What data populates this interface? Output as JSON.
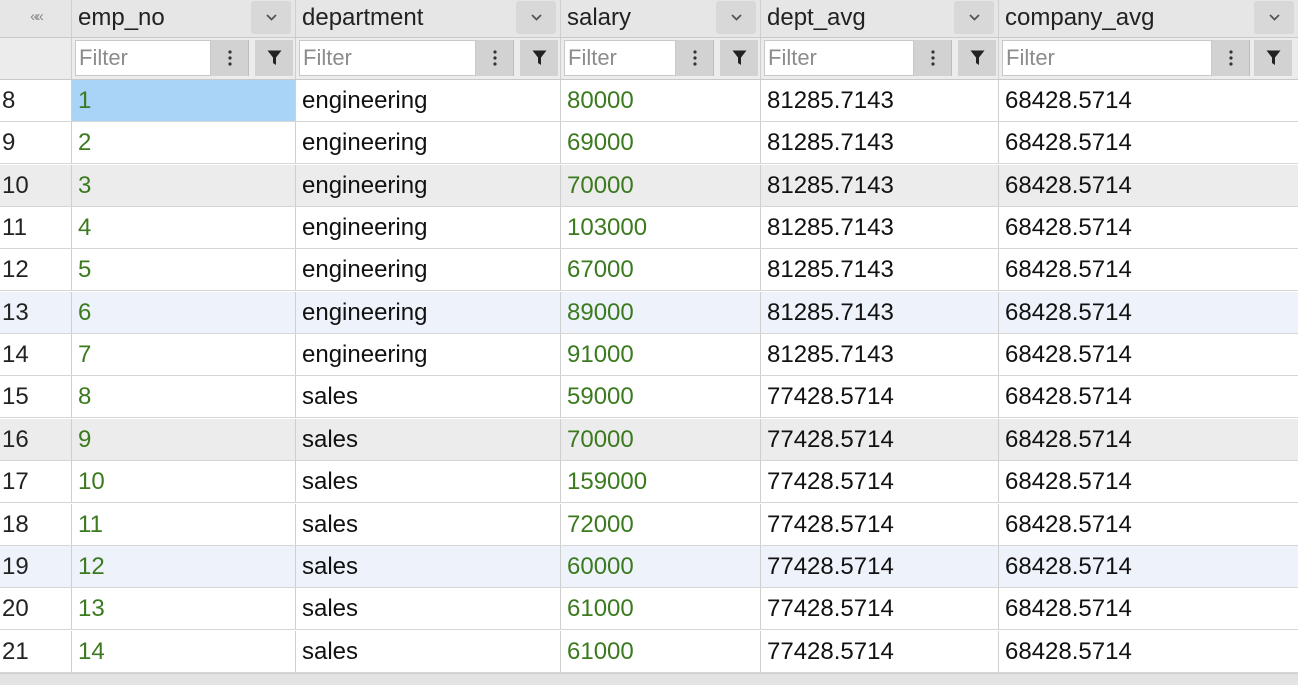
{
  "columns": [
    {
      "key": "emp_no",
      "label": "emp_no"
    },
    {
      "key": "department",
      "label": "department"
    },
    {
      "key": "salary",
      "label": "salary"
    },
    {
      "key": "dept_avg",
      "label": "dept_avg"
    },
    {
      "key": "company_avg",
      "label": "company_avg"
    }
  ],
  "collapse_glyph": "««",
  "filter_placeholder": "Filter",
  "colors": {
    "numeric_text": "#3b7a1f",
    "selected_cell": "#a9d3f7",
    "striped_row": "#ececec",
    "hover_row": "#eef3fb"
  },
  "icons": {
    "sort": "chevron-down-icon",
    "menu": "kebab-menu-icon",
    "filter": "funnel-icon"
  },
  "selected_cell": {
    "row": 0,
    "column": "emp_no"
  },
  "rows": [
    {
      "index": "8",
      "emp_no": "1",
      "department": "engineering",
      "salary": "80000",
      "dept_avg": "81285.7143",
      "company_avg": "68428.5714",
      "style": "even"
    },
    {
      "index": "9",
      "emp_no": "2",
      "department": "engineering",
      "salary": "69000",
      "dept_avg": "81285.7143",
      "company_avg": "68428.5714",
      "style": "even"
    },
    {
      "index": "10",
      "emp_no": "3",
      "department": "engineering",
      "salary": "70000",
      "dept_avg": "81285.7143",
      "company_avg": "68428.5714",
      "style": "odd"
    },
    {
      "index": "11",
      "emp_no": "4",
      "department": "engineering",
      "salary": "103000",
      "dept_avg": "81285.7143",
      "company_avg": "68428.5714",
      "style": "even"
    },
    {
      "index": "12",
      "emp_no": "5",
      "department": "engineering",
      "salary": "67000",
      "dept_avg": "81285.7143",
      "company_avg": "68428.5714",
      "style": "even"
    },
    {
      "index": "13",
      "emp_no": "6",
      "department": "engineering",
      "salary": "89000",
      "dept_avg": "81285.7143",
      "company_avg": "68428.5714",
      "style": "hover"
    },
    {
      "index": "14",
      "emp_no": "7",
      "department": "engineering",
      "salary": "91000",
      "dept_avg": "81285.7143",
      "company_avg": "68428.5714",
      "style": "even"
    },
    {
      "index": "15",
      "emp_no": "8",
      "department": "sales",
      "salary": "59000",
      "dept_avg": "77428.5714",
      "company_avg": "68428.5714",
      "style": "even"
    },
    {
      "index": "16",
      "emp_no": "9",
      "department": "sales",
      "salary": "70000",
      "dept_avg": "77428.5714",
      "company_avg": "68428.5714",
      "style": "odd"
    },
    {
      "index": "17",
      "emp_no": "10",
      "department": "sales",
      "salary": "159000",
      "dept_avg": "77428.5714",
      "company_avg": "68428.5714",
      "style": "even"
    },
    {
      "index": "18",
      "emp_no": "11",
      "department": "sales",
      "salary": "72000",
      "dept_avg": "77428.5714",
      "company_avg": "68428.5714",
      "style": "even"
    },
    {
      "index": "19",
      "emp_no": "12",
      "department": "sales",
      "salary": "60000",
      "dept_avg": "77428.5714",
      "company_avg": "68428.5714",
      "style": "hover"
    },
    {
      "index": "20",
      "emp_no": "13",
      "department": "sales",
      "salary": "61000",
      "dept_avg": "77428.5714",
      "company_avg": "68428.5714",
      "style": "even"
    },
    {
      "index": "21",
      "emp_no": "14",
      "department": "sales",
      "salary": "61000",
      "dept_avg": "77428.5714",
      "company_avg": "68428.5714",
      "style": "even"
    }
  ]
}
